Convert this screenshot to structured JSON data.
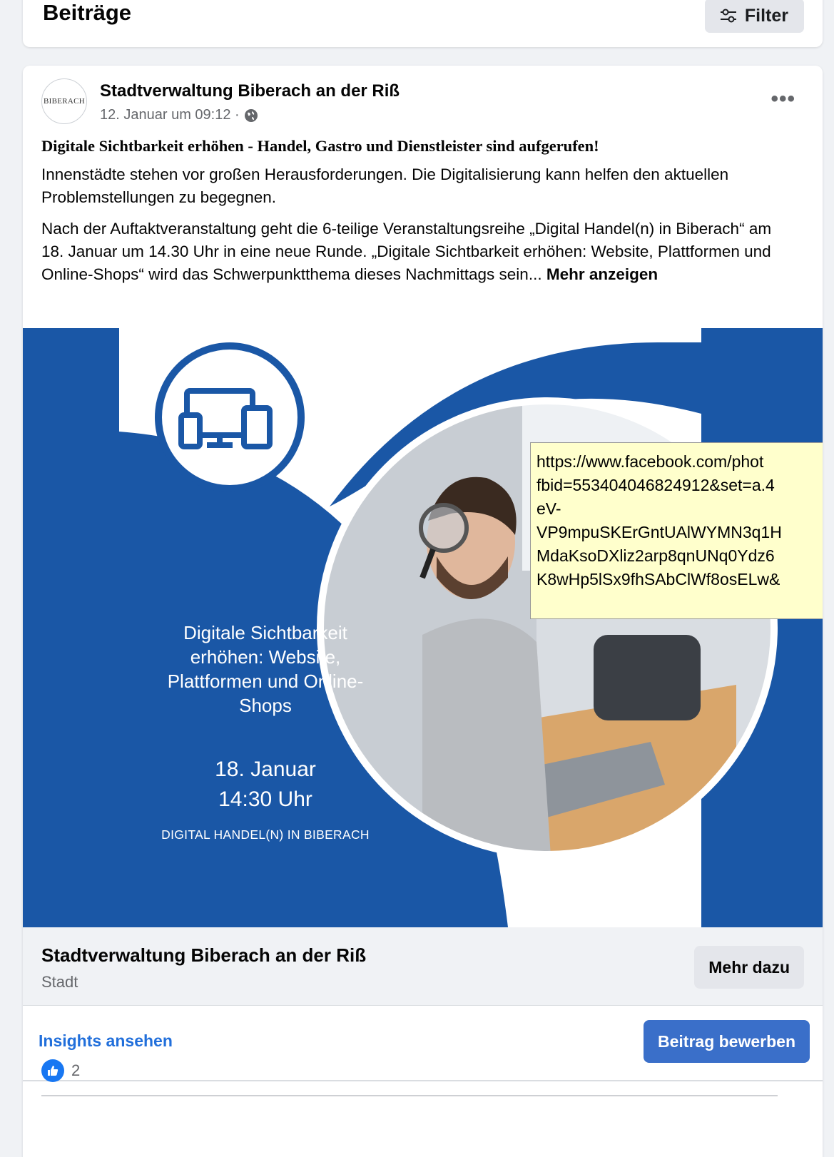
{
  "section": {
    "title": "Beiträge",
    "filter_label": "Filter"
  },
  "post": {
    "author": "Stadtverwaltung Biberach an der Riß",
    "avatar_text": "BIBERACH",
    "date": "12. Januar um 09:12 ·",
    "headline": "Digitale Sichtbarkeit erhöhen - Handel, Gastro und Dienstleister sind aufgerufen!",
    "paragraph1": "Innenstädte stehen vor großen Herausforderungen. Die Digitalisierung kann helfen den aktuellen Problemstellungen zu begegnen.",
    "paragraph2": "Nach der Auftaktveranstaltung geht die 6-teilige Veranstaltungsreihe „Digital Handel(n) in Biberach“ am 18. Januar um 14.30 Uhr in eine neue Runde. „Digitale Sichtbarkeit erhöhen: Website, Plattformen und Online-Shops“ wird das Schwerpunktthema dieses Nachmittags sein...",
    "see_more": "Mehr anzeigen"
  },
  "poster": {
    "title": "Digitale Sichtbarkeit erhöhen: Website, Plattformen und Online-Shops",
    "date": "18. Januar",
    "time": "14:30 Uhr",
    "tagline": "DIGITAL HANDEL(N) IN BIBERACH",
    "brand_blue": "#1a57a6"
  },
  "tooltip": {
    "text": "https://www.facebook.com/phot\nfbid=553404046824912&set=a.4\neV-\nVP9mpuSKErGntUAlWYMN3q1H\nMdaKsoDXliz2arp8qnUNq0Ydz6\nK8wHp5lSx9fhSAbClWf8osELw&"
  },
  "link": {
    "title": "Stadtverwaltung Biberach an der Riß",
    "subtitle": "Stadt",
    "button": "Mehr dazu"
  },
  "actions": {
    "insights": "Insights ansehen",
    "boost": "Beitrag bewerben"
  },
  "reactions": {
    "count": "2"
  }
}
